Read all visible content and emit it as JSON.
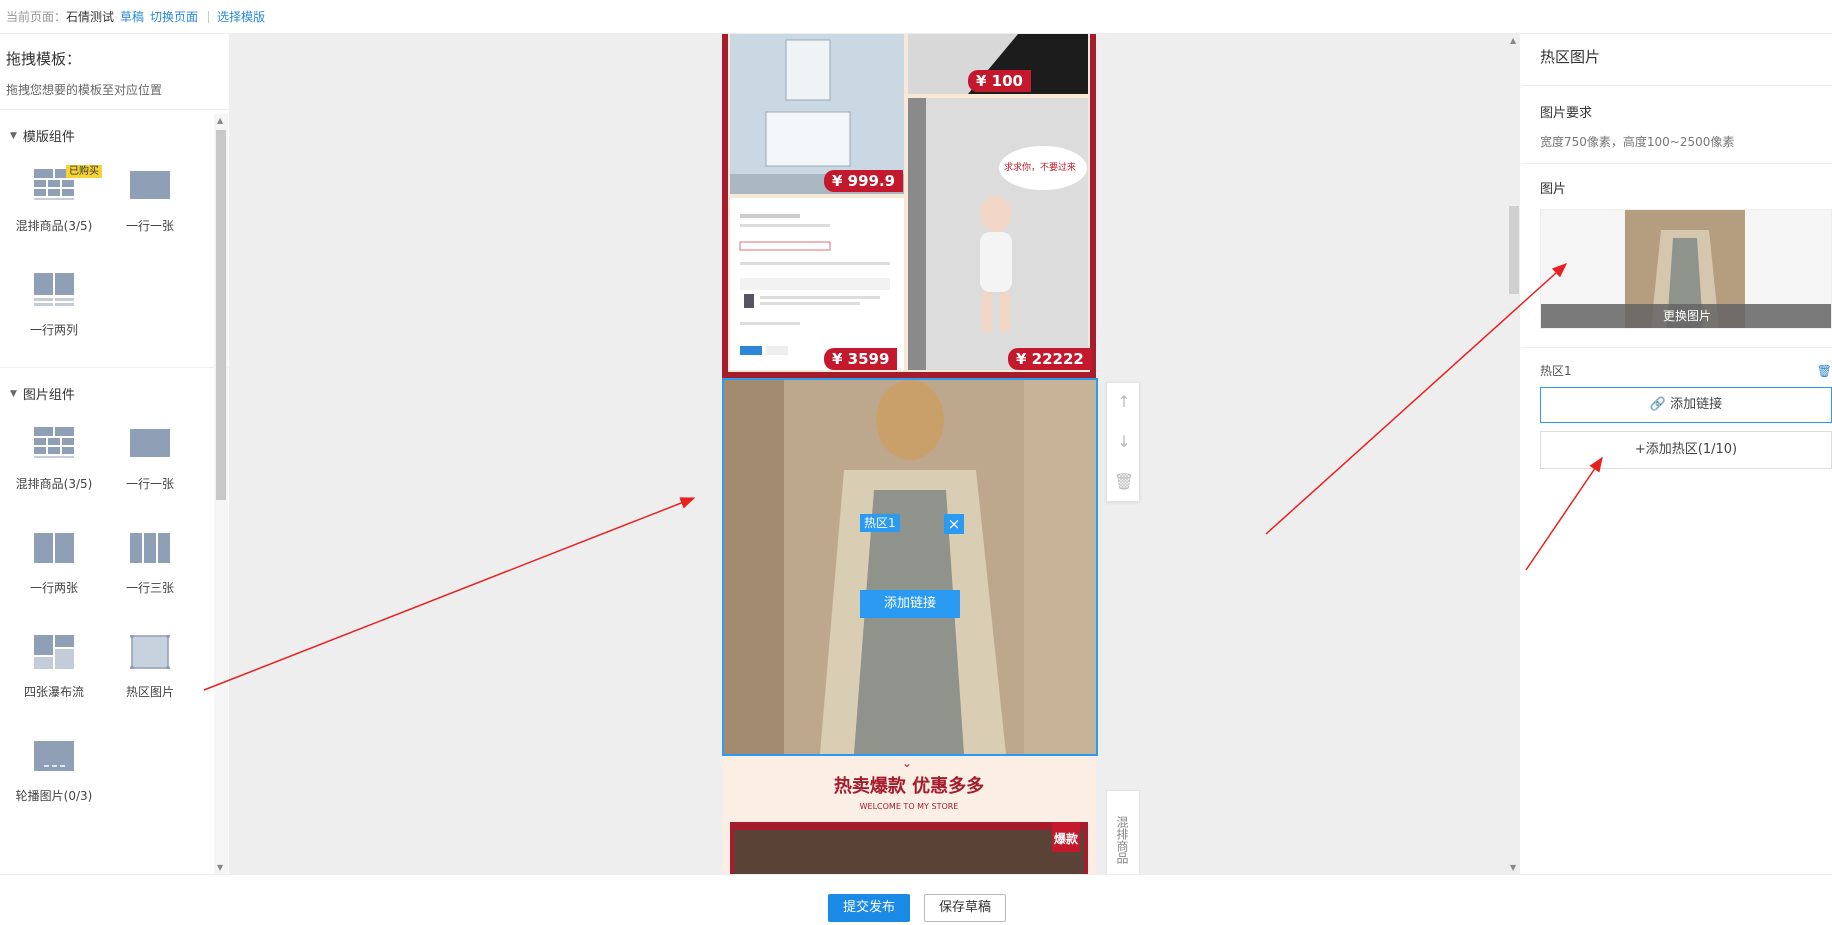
{
  "topbar": {
    "current_label": "当前页面：",
    "page_name": "石倩测试",
    "status": "草稿",
    "switch_page": "切换页面",
    "choose_template": "选择模版"
  },
  "left": {
    "title": "拖拽模板：",
    "desc": "拖拽您想要的模板至对应位置",
    "sections": [
      {
        "title": "模版组件",
        "items": [
          {
            "label": "混排商品(3/5)",
            "icon": "mixed-goods-icon",
            "badge": "已购买"
          },
          {
            "label": "一行一张",
            "icon": "one-per-row-icon"
          },
          {
            "label": "一行两列",
            "icon": "two-columns-icon"
          }
        ]
      },
      {
        "title": "图片组件",
        "items": [
          {
            "label": "混排商品(3/5)",
            "icon": "mixed-goods-icon"
          },
          {
            "label": "一行一张",
            "icon": "one-per-row-icon"
          },
          {
            "label": "一行两张",
            "icon": "two-per-row-icon"
          },
          {
            "label": "一行三张",
            "icon": "three-per-row-icon"
          },
          {
            "label": "四张瀑布流",
            "icon": "waterfall-icon"
          },
          {
            "label": "热区图片",
            "icon": "hotspot-image-icon"
          },
          {
            "label": "轮播图片(0/3)",
            "icon": "carousel-icon"
          }
        ]
      }
    ]
  },
  "canvas": {
    "prices": [
      "¥ 100",
      "¥ 999.9",
      "¥ 3599",
      "¥ 22222"
    ],
    "bubble_text": "求求你，不要过来",
    "hotzone_label": "热区1",
    "hotzone_add_link": "添加链接",
    "banner_title": "热卖爆款 优惠多多",
    "banner_sub": "WELCOME TO MY STORE",
    "banner_tag": "爆款",
    "side_tool_label": "混排商品"
  },
  "right": {
    "title": "热区图片",
    "req_title": "图片要求",
    "req_value": "宽度750像素，高度100~2500像素",
    "image_title": "图片",
    "change_image": "更换图片",
    "zone_name": "热区1",
    "add_link": "添加链接",
    "add_zone": "+添加热区(1/10)"
  },
  "bottom": {
    "publish": "提交发布",
    "save_draft": "保存草稿"
  },
  "colors": {
    "accent": "#2b9af3",
    "brand_red": "#a51d2d",
    "annotation": "#e8201f"
  }
}
